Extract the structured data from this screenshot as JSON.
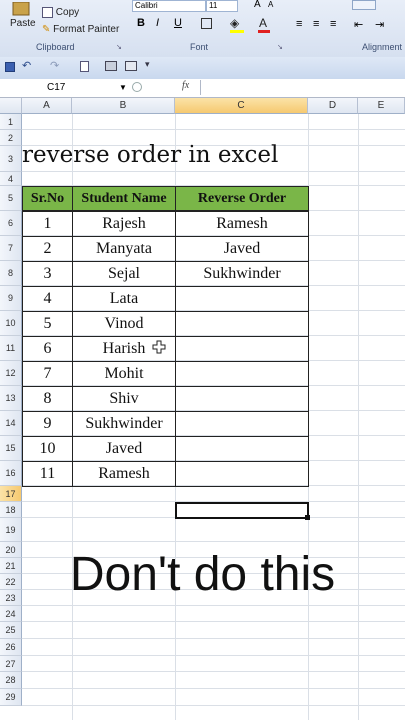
{
  "ribbon": {
    "paste_label": "Paste",
    "copy_label": "Copy",
    "format_painter_label": "Format Painter",
    "clipboard_label": "Clipboard",
    "font_name": "Calibri",
    "font_size": "11",
    "font_label": "Font",
    "alignment_label": "Alignment",
    "bold": "B",
    "italic": "I",
    "underline": "U"
  },
  "formula_bar": {
    "name_box": "C17",
    "fx": "fx",
    "value": ""
  },
  "columns": [
    "A",
    "B",
    "C",
    "D",
    "E"
  ],
  "rows": [
    "1",
    "2",
    "3",
    "4",
    "5",
    "6",
    "7",
    "8",
    "9",
    "10",
    "11",
    "12",
    "13",
    "14",
    "15",
    "16",
    "17",
    "18",
    "19",
    "20",
    "21",
    "22",
    "23",
    "24",
    "25",
    "26",
    "27",
    "28",
    "29"
  ],
  "sheet": {
    "title": "reverse order in excel",
    "headers": {
      "srno": "Sr.No",
      "name": "Student Name",
      "reverse": "Reverse Order"
    },
    "srno": [
      "1",
      "2",
      "3",
      "4",
      "5",
      "6",
      "7",
      "8",
      "9",
      "10",
      "11"
    ],
    "names": [
      "Rajesh",
      "Manyata",
      "Sejal",
      "Lata",
      "Vinod",
      "Harish",
      "Mohit",
      "Shiv",
      "Sukhwinder",
      "Javed",
      "Ramesh"
    ],
    "reverse": [
      "Ramesh",
      "Javed",
      "Sukhwinder",
      "",
      "",
      "",
      "",
      "",
      "",
      "",
      ""
    ]
  },
  "overlay_text": "Don't do this",
  "colors": {
    "header_green": "#7ab648",
    "ribbon": "#dfe8f6"
  }
}
